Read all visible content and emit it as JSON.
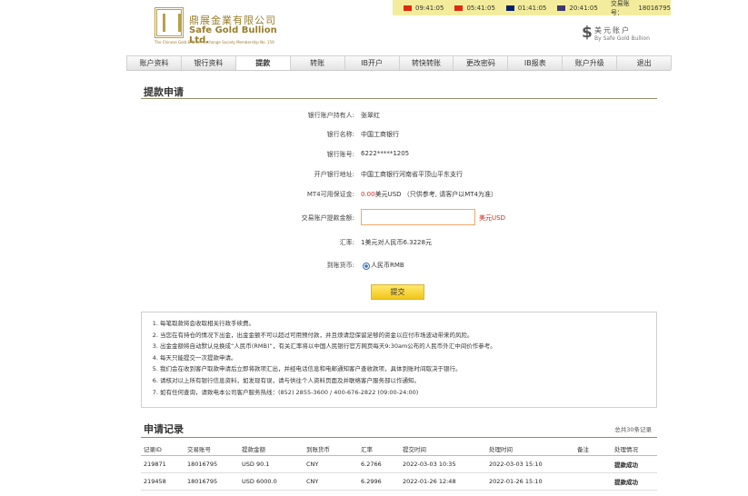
{
  "logo": {
    "cn": "鼎展金業有限公司",
    "en": "Safe Gold Bullion Ltd.",
    "sub": "The Chinese Gold & Silver Exchange Society Membership No. 159"
  },
  "timebar": {
    "clocks": [
      {
        "flag": "hk-flag",
        "time": "09:41:05",
        "color": "#de2910"
      },
      {
        "flag": "cn-flag",
        "time": "05:41:05",
        "color": "#de2910"
      },
      {
        "flag": "uk-flag",
        "time": "01:41:05",
        "color": "#012169"
      },
      {
        "flag": "us-flag",
        "time": "20:41:05",
        "color": "#3c3b6e"
      }
    ],
    "account_label": "交易账号：",
    "account_no": "18016795"
  },
  "brand": {
    "symbol": "$",
    "line1": "美元账户",
    "line2": "By Safe Gold Bullion"
  },
  "nav": [
    "账户资料",
    "银行资料",
    "提款",
    "转账",
    "IB开户",
    "转快转账",
    "更改密码",
    "IB报表",
    "账户升级",
    "退出"
  ],
  "nav_active": 2,
  "form": {
    "title": "提款申请",
    "holder_label": "银行账户持有人:",
    "holder": "张翠红",
    "bank_label": "银行名称:",
    "bank": "中国工商银行",
    "account_label": "银行账号:",
    "account": "6222*****1205",
    "branch_label": "开户银行地址:",
    "branch": "中国工商银行河南省平顶山平东支行",
    "margin_label": "MT4可用保证金:",
    "margin_value": "0.00",
    "margin_text": "美元USD （只供参考, 请客户以MT4为准）",
    "amount_label": "交易账户提款金额:",
    "amount_value": "",
    "amount_unit": "美元USD",
    "rate_label": "汇率:",
    "rate": "1美元对人民币6.3228元",
    "currency_label": "到账货币:",
    "currency": "人民币RMB",
    "submit": "提交"
  },
  "notes": [
    "每笔取款将会收取相关行政手续费。",
    "当您在有持仓的情况下出金，出金金额不可以超过可用预付款，并且烦请您保留足够的资金以应付市场波动带来的风险。",
    "出金金额将自动默认兑换成“人民币(RMB)”，有关汇率将以中国人民银行官方网页每天9:30am公布的人民币外汇中间价作参考。",
    "每天只能提交一次提款申请。",
    "我们会在收到客户取款申请后立即将款项汇出，并经电话信息和电邮通知客户查收款项，具体到账时间取决于银行。",
    "请核对以上所有银行信息资料，如发现有误，请与供往个人资料页面及并联络客户服务部以作通知。",
    "如有任何查询，请致电本公司客户服务热线：(852) 2855-3600 / 400-676-2822 (09:00-24:00)"
  ],
  "records": {
    "title": "申请记录",
    "count": "总共30条记录",
    "headers": [
      "记录ID",
      "交易账号",
      "提款金额",
      "到账货币",
      "汇率",
      "提交时间",
      "处理时间",
      "备注",
      "处理情况"
    ],
    "rows": [
      [
        "219871",
        "18016795",
        "USD 90.1",
        "CNY",
        "6.2766",
        "2022-03-03 10:35",
        "2022-03-03 15:10",
        "",
        "提款成功"
      ],
      [
        "219458",
        "18016795",
        "USD 6000.0",
        "CNY",
        "6.2996",
        "2022-01-26 12:48",
        "2022-01-26 15:10",
        "",
        "提款成功"
      ]
    ]
  }
}
